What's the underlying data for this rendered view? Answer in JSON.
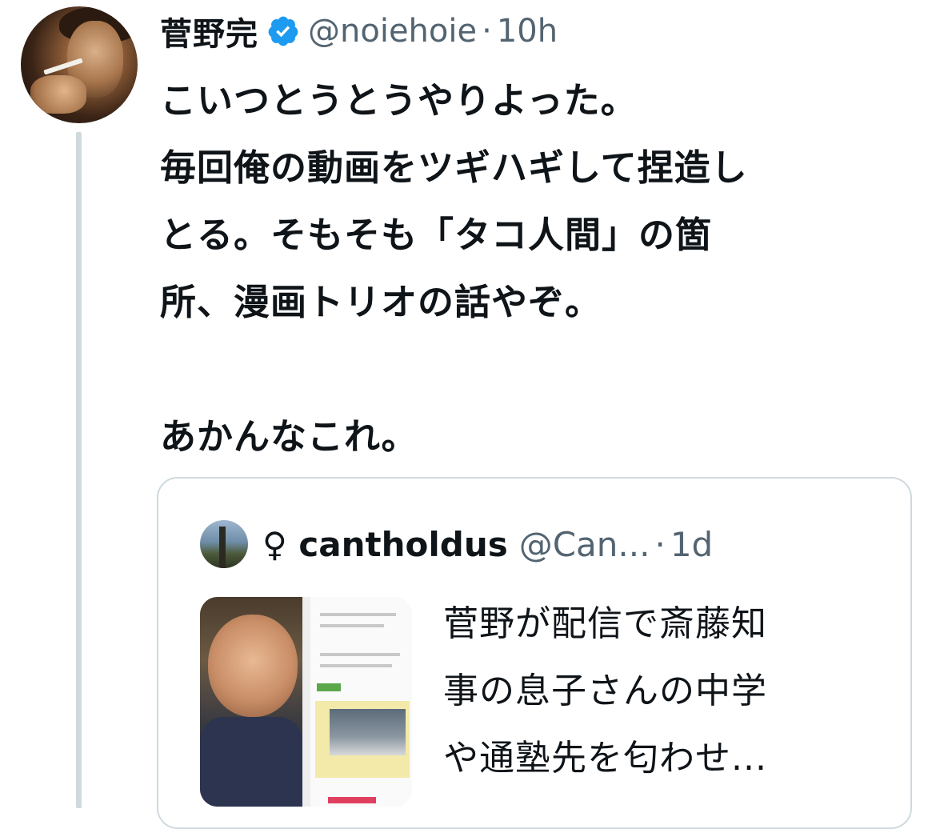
{
  "tweet": {
    "author_name": "菅野完",
    "handle": "@noiehoie",
    "separator": "·",
    "timestamp": "10h",
    "verified_icon": "verified-badge-icon",
    "verified_color": "#1d9bf0",
    "text_lines": [
      "こいつとうとうやりよった。",
      "毎回俺の動画をツギハギして捏造し",
      "とる。そもそも「タコ人間」の箇",
      "所、漫画トリオの話やぞ。",
      "",
      "あかんなこれ。"
    ]
  },
  "quote": {
    "author_name": "♀ cantholdus",
    "handle": "@Can...",
    "separator": "·",
    "timestamp": "1d",
    "text_lines": [
      "菅野が配信で斎藤知",
      "事の息子さんの中学",
      "や通塾先を匂わせ..."
    ]
  },
  "colors": {
    "text": "#0f1419",
    "secondary_text": "#536471",
    "border": "#cfd9de"
  }
}
